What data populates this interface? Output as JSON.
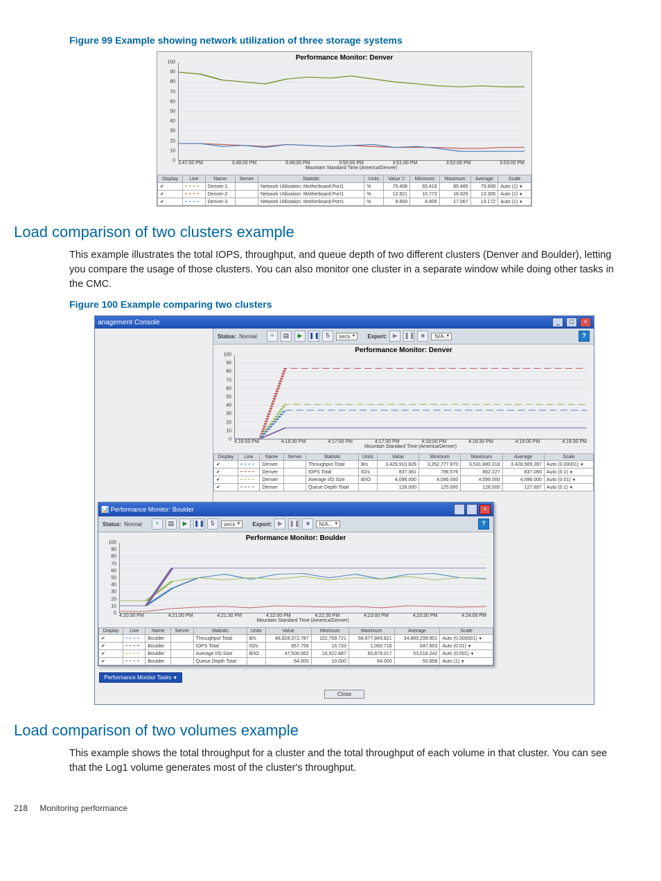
{
  "figure99": {
    "caption": "Figure 99 Example showing network utilization of three storage systems",
    "chart_title": "Performance Monitor: Denver",
    "x_label": "Mountain Standard Time (America/Denver)",
    "headers": [
      "Display",
      "Line",
      "Name",
      "Server",
      "Statistic",
      "Units",
      "Value ▽",
      "Minimum",
      "Maximum",
      "Average",
      "Scale"
    ],
    "rows": [
      {
        "display": "✔",
        "color": "#6b8e23",
        "name": "Denver-1",
        "server": "",
        "statistic": "Network Utilization: Motherboard:Port1",
        "units": "%",
        "value": "75.408",
        "minimum": "65.419",
        "maximum": "85.485",
        "average": "79.899",
        "scale": "Auto (1)"
      },
      {
        "display": "✔",
        "color": "#c0504d",
        "name": "Denver-2",
        "server": "",
        "statistic": "Network Utilization: Motherboard:Port1",
        "units": "%",
        "value": "12.821",
        "minimum": "10.773",
        "maximum": "16.929",
        "average": "13.305",
        "scale": "Auto (1)"
      },
      {
        "display": "✔",
        "color": "#4f81bd",
        "name": "Denver-3",
        "server": "",
        "statistic": "Network Utilization: Motherboard:Port1",
        "units": "%",
        "value": "8.809",
        "minimum": "8.809",
        "maximum": "17.067",
        "average": "13.172",
        "scale": "Auto (1)"
      }
    ]
  },
  "section1": {
    "heading": "Load comparison of two clusters example",
    "paragraph": "This example illustrates the total IOPS, throughput, and queue depth of two different clusters (Denver and Boulder), letting you compare the usage of those clusters. You can also monitor one cluster in a separate window while doing other tasks in the CMC."
  },
  "figure100": {
    "caption": "Figure 100 Example comparing two clusters",
    "app_title": "anagement Console",
    "toolbar": {
      "status_label": "Status:",
      "status_value": "Normal",
      "time_unit": "secs",
      "export_label": "Export:",
      "na_btn": "N/A..."
    },
    "denver": {
      "chart_title": "Performance Monitor: Denver",
      "x_label": "Mountain Standard Time (America/Denver)",
      "headers": [
        "Display",
        "Line",
        "Name",
        "Server",
        "Statistic",
        "Units",
        "Value",
        "Minimum",
        "Maximum",
        "Average",
        "Scale"
      ],
      "rows": [
        {
          "display": "✔",
          "color": "#4f81bd",
          "name": "Denver",
          "server": "",
          "statistic": "Throughput Total",
          "units": "B/s",
          "value": "3,429,910.828",
          "minimum": "3,262,777.870",
          "maximum": "3,531,680.318",
          "average": "3,428,569.287",
          "scale": "Auto (0.00001)"
        },
        {
          "display": "✔",
          "color": "#c0504d",
          "name": "Denver",
          "server": "",
          "statistic": "IOPS Total",
          "units": "IO/s",
          "value": "837.381",
          "minimum": "796.576",
          "maximum": "862.227",
          "average": "837.060",
          "scale": "Auto (0.1)"
        },
        {
          "display": "✔",
          "color": "#9bbb59",
          "name": "Denver",
          "server": "",
          "statistic": "Average I/O Size",
          "units": "B/IO",
          "value": "4,096.000",
          "minimum": "4,096.000",
          "maximum": "4,096.000",
          "average": "4,096.000",
          "scale": "Auto (0.01)"
        },
        {
          "display": "✔",
          "color": "#8064a2",
          "name": "Denver",
          "server": "",
          "statistic": "Queue Depth Total",
          "units": "",
          "value": "128.000",
          "minimum": "125.000",
          "maximum": "128.000",
          "average": "127.697",
          "scale": "Auto (0.1)"
        }
      ]
    },
    "boulder": {
      "window_title": "Performance Monitor: Boulder",
      "toolbar": {
        "status_label": "Status:",
        "status_value": "Normal",
        "time_unit": "secs",
        "export_label": "Export:",
        "na_btn": "N/A..."
      },
      "chart_title": "Performance Monitor: Boulder",
      "x_label": "Mountain Standard Time (America/Denver)",
      "headers": [
        "Display",
        "Line",
        "Name",
        "Server",
        "Statistic",
        "Units",
        "Value",
        "Minimum",
        "Maximum",
        "Average",
        "Scale"
      ],
      "rows": [
        {
          "display": "✔",
          "color": "#4f81bd",
          "name": "Boulder",
          "server": "",
          "statistic": "Throughput Total",
          "units": "B/s",
          "value": "48,828,372.787",
          "minimum": "102,769.721",
          "maximum": "56,977,849.821",
          "average": "34,889,299.901",
          "scale": "Auto (0.000001)"
        },
        {
          "display": "✔",
          "color": "#c0504d",
          "name": "Boulder",
          "server": "",
          "statistic": "IOPS Total",
          "units": "IO/s",
          "value": "857.758",
          "minimum": "16.733",
          "maximum": "1,093.716",
          "average": "647.603",
          "scale": "Auto (0.01)"
        },
        {
          "display": "✔",
          "color": "#9bbb59",
          "name": "Boulder",
          "server": "",
          "statistic": "Average I/O Size",
          "units": "B/IO",
          "value": "47,508.062",
          "minimum": "16,922.887",
          "maximum": "60,878.017",
          "average": "53,518.242",
          "scale": "Auto (0.001)"
        },
        {
          "display": "✔",
          "color": "#8064a2",
          "name": "Boulder",
          "server": "",
          "statistic": "Queue Depth Total",
          "units": "",
          "value": "64.000",
          "minimum": "10.000",
          "maximum": "64.000",
          "average": "50.858",
          "scale": "Auto (1)"
        }
      ]
    },
    "tasks_btn": "Performance Monitor Tasks",
    "close_btn": "Close"
  },
  "section2": {
    "heading": "Load comparison of two volumes example",
    "paragraph": "This example shows the total throughput for a cluster and the total throughput of each volume in that cluster. You can see that the Log1 volume generates most of the cluster's throughput."
  },
  "footer": {
    "page_number": "218",
    "chapter": "Monitoring performance"
  },
  "chart_data": [
    {
      "id": "figure99",
      "type": "line",
      "title": "Performance Monitor: Denver",
      "xlabel": "Mountain Standard Time (America/Denver)",
      "ylabel": "",
      "ylim": [
        0,
        100
      ],
      "x_ticks": [
        "3:47:00 PM",
        "3:48:00 PM",
        "3:49:00 PM",
        "3:50:00 PM",
        "3:51:00 PM",
        "3:52:00 PM",
        "3:53:00 PM"
      ],
      "series": [
        {
          "name": "Denver-1",
          "color": "#6b8e23",
          "values": [
            90,
            88,
            82,
            80,
            78,
            83,
            85,
            84,
            86,
            83,
            80,
            78,
            76,
            75,
            76,
            75,
            75
          ]
        },
        {
          "name": "Denver-2",
          "color": "#c0504d",
          "values": [
            17,
            17,
            16,
            15,
            14,
            16,
            15,
            14,
            15,
            14,
            13,
            13,
            13,
            12,
            12,
            13,
            13
          ]
        },
        {
          "name": "Denver-3",
          "color": "#4f81bd",
          "values": [
            17,
            17,
            14,
            15,
            13,
            16,
            15,
            14,
            15,
            16,
            13,
            14,
            12,
            9,
            9,
            9,
            9
          ]
        }
      ]
    },
    {
      "id": "figure100-denver",
      "type": "line",
      "title": "Performance Monitor: Denver",
      "xlabel": "Mountain Standard Time (America/Denver)",
      "ylim": [
        0,
        100
      ],
      "x_ticks": [
        "4:16:00 PM",
        "4:16:30 PM",
        "4:17:00 PM",
        "4:17:30 PM",
        "4:18:00 PM",
        "4:18:30 PM",
        "4:19:00 PM",
        "4:19:30 PM"
      ],
      "series": [
        {
          "name": "Denver IOPS",
          "color": "#c0504d",
          "style": "dashed",
          "values": [
            0,
            0,
            84,
            84,
            84,
            84,
            84,
            84,
            84,
            84,
            84,
            84,
            84,
            84,
            84
          ]
        },
        {
          "name": "Denver Avg I/O",
          "color": "#9bbb59",
          "style": "dashed",
          "values": [
            0,
            0,
            41,
            41,
            41,
            41,
            41,
            41,
            41,
            41,
            41,
            41,
            41,
            41,
            41
          ]
        },
        {
          "name": "Denver Throughput",
          "color": "#4f81bd",
          "style": "dashed",
          "values": [
            0,
            0,
            34,
            34,
            34,
            34,
            34,
            34,
            34,
            34,
            34,
            34,
            34,
            34,
            34
          ]
        },
        {
          "name": "Denver Queue",
          "color": "#8064a2",
          "style": "solid",
          "values": [
            0,
            0,
            13,
            13,
            13,
            13,
            13,
            13,
            13,
            13,
            13,
            13,
            13,
            13,
            13
          ]
        }
      ]
    },
    {
      "id": "figure100-boulder",
      "type": "line",
      "title": "Performance Monitor: Boulder",
      "xlabel": "Mountain Standard Time (America/Denver)",
      "ylim": [
        0,
        100
      ],
      "x_ticks": [
        "4:20:30 PM",
        "4:21:00 PM",
        "4:21:30 PM",
        "4:22:00 PM",
        "4:22:30 PM",
        "4:23:00 PM",
        "4:23:30 PM",
        "4:24:00 PM"
      ],
      "series": [
        {
          "name": "Boulder Throughput",
          "color": "#4f81bd",
          "values": [
            10,
            10,
            35,
            50,
            55,
            48,
            55,
            56,
            50,
            55,
            48,
            55,
            56,
            50,
            49
          ]
        },
        {
          "name": "Boulder IOPS",
          "color": "#c0504d",
          "values": [
            2,
            2,
            6,
            8,
            9,
            7,
            10,
            9,
            8,
            9,
            7,
            10,
            9,
            8,
            9
          ]
        },
        {
          "name": "Boulder Avg I/O",
          "color": "#9bbb59",
          "values": [
            17,
            17,
            45,
            50,
            47,
            50,
            48,
            52,
            47,
            50,
            48,
            52,
            47,
            50,
            48
          ]
        },
        {
          "name": "Boulder Queue",
          "color": "#8064a2",
          "values": [
            10,
            10,
            64,
            64,
            64,
            64,
            64,
            64,
            64,
            64,
            64,
            64,
            64,
            64,
            64
          ]
        }
      ]
    }
  ]
}
